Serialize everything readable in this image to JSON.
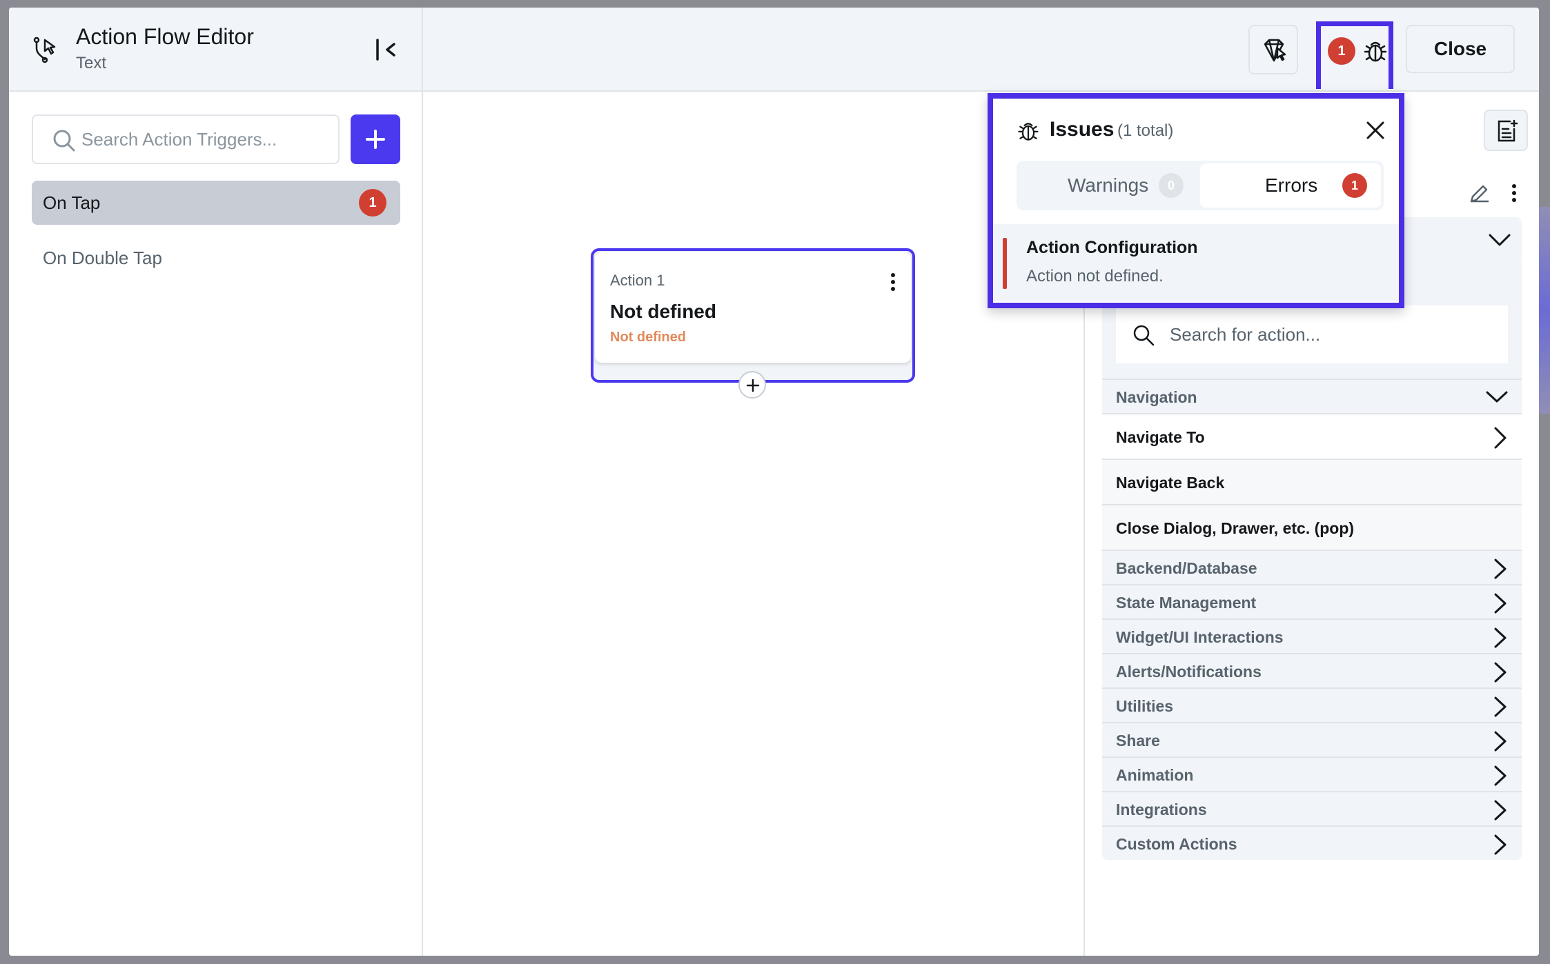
{
  "header": {
    "title": "Action Flow Editor",
    "subtitle": "Text",
    "close_label": "Close",
    "error_count": "1"
  },
  "sidebar": {
    "search_placeholder": "Search Action Triggers...",
    "triggers": [
      {
        "label": "On Tap",
        "badge": "1",
        "active": true
      },
      {
        "label": "On Double Tap",
        "active": false
      }
    ]
  },
  "canvas": {
    "node": {
      "label": "Action 1",
      "title": "Not defined",
      "subtitle": "Not defined"
    }
  },
  "issues": {
    "title": "Issues",
    "count_text": "(1 total)",
    "tabs": [
      {
        "label": "Warnings",
        "count": "0"
      },
      {
        "label": "Errors",
        "count": "1"
      }
    ],
    "items": [
      {
        "title": "Action Configuration",
        "message": "Action not defined."
      }
    ]
  },
  "action_panel": {
    "search_placeholder": "Search for action...",
    "navigation": {
      "label": "Navigation",
      "items": [
        "Navigate To",
        "Navigate Back",
        "Close Dialog, Drawer, etc. (pop)"
      ]
    },
    "categories": [
      "Backend/Database",
      "State Management",
      "Widget/UI Interactions",
      "Alerts/Notifications",
      "Utilities",
      "Share",
      "Animation",
      "Integrations",
      "Custom Actions"
    ]
  },
  "colors": {
    "accent": "#4b39ef",
    "highlight": "#4b2ee6",
    "error": "#d13f33",
    "warning_text": "#e08a5a"
  }
}
